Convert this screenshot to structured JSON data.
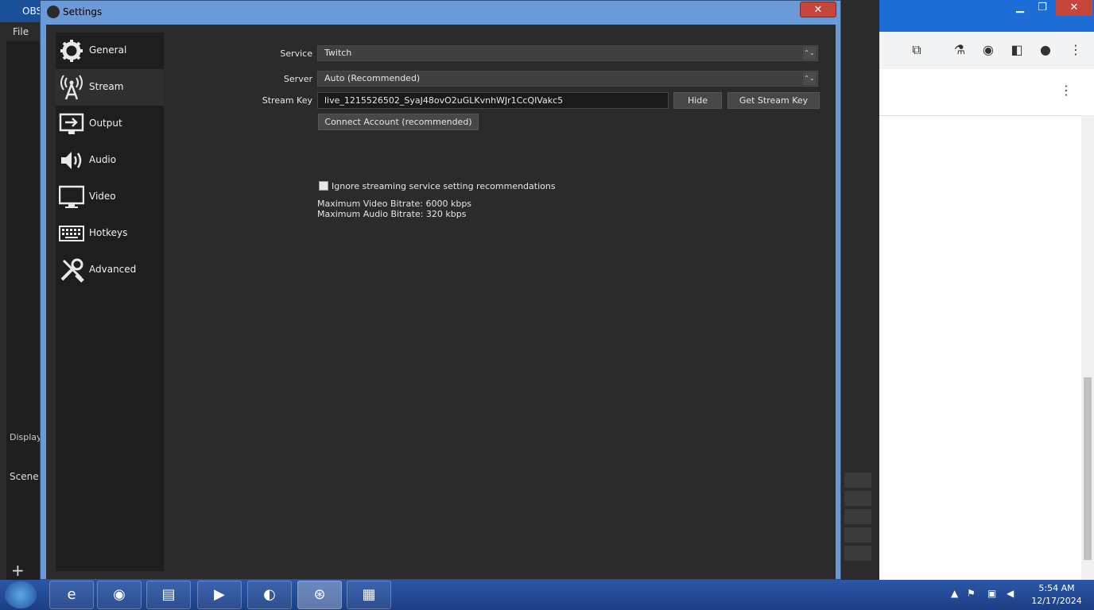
{
  "obs_main": {
    "title": "OBS",
    "menu_file": "File",
    "display_label": "Display",
    "scene_label": "Scene",
    "add_icon": "plus-icon"
  },
  "settings": {
    "title": "Settings",
    "close": "✕",
    "nav": [
      {
        "label": "General",
        "icon": "gear-icon"
      },
      {
        "label": "Stream",
        "icon": "broadcast-antenna-icon"
      },
      {
        "label": "Output",
        "icon": "output-icon"
      },
      {
        "label": "Audio",
        "icon": "speaker-icon"
      },
      {
        "label": "Video",
        "icon": "monitor-icon"
      },
      {
        "label": "Hotkeys",
        "icon": "keyboard-icon"
      },
      {
        "label": "Advanced",
        "icon": "wrench-screwdriver-icon"
      }
    ],
    "form": {
      "service_label": "Service",
      "service_value": "Twitch",
      "server_label": "Server",
      "server_value": "Auto (Recommended)",
      "stream_key_label": "Stream Key",
      "stream_key_value": "live_1215526502_SyaJ48ovO2uGLKvnhWJr1CcQIVakc5",
      "hide_button": "Hide",
      "get_key_button": "Get Stream Key",
      "connect_button": "Connect Account (recommended)",
      "ignore_checkbox": "Ignore streaming service setting recommendations",
      "max_video": "Maximum Video Bitrate: 6000 kbps",
      "max_audio": "Maximum Audio Bitrate: 320 kbps"
    }
  },
  "taskbar": {
    "time": "5:54 AM",
    "date": "12/17/2024",
    "apps": [
      "internet-explorer-icon",
      "firefox-icon",
      "file-explorer-icon",
      "media-player-icon",
      "chat-app-icon",
      "obs-icon",
      "control-panel-icon"
    ]
  }
}
